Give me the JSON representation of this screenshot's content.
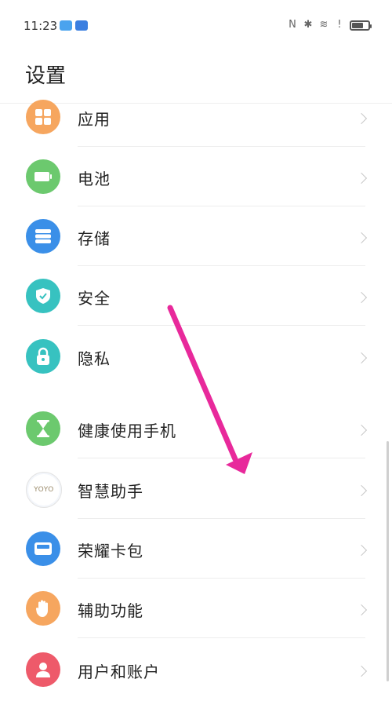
{
  "status": {
    "time": "11:23",
    "battery_level": 0.7
  },
  "page": {
    "title": "设置"
  },
  "items": [
    {
      "label": "应用",
      "icon": "apps-icon",
      "color": "#f6a65f"
    },
    {
      "label": "电池",
      "icon": "battery-icon",
      "color": "#6cc96e"
    },
    {
      "label": "存储",
      "icon": "storage-icon",
      "color": "#3a8fe8"
    },
    {
      "label": "安全",
      "icon": "shield-icon",
      "color": "#37c2c0"
    },
    {
      "label": "隐私",
      "icon": "lock-icon",
      "color": "#37c2c0"
    },
    {
      "label": "健康使用手机",
      "icon": "hourglass-icon",
      "color": "#6cc96e"
    },
    {
      "label": "智慧助手",
      "icon": "yoyo-icon",
      "color": "#ffffff",
      "icon_text": "YOYO"
    },
    {
      "label": "荣耀卡包",
      "icon": "wallet-icon",
      "color": "#3a8fe8"
    },
    {
      "label": "辅助功能",
      "icon": "hand-icon",
      "color": "#f6a65f"
    },
    {
      "label": "用户和账户",
      "icon": "user-icon",
      "color": "#ee5a6a"
    }
  ],
  "annotation": {
    "arrow_color": "#e8299b"
  }
}
